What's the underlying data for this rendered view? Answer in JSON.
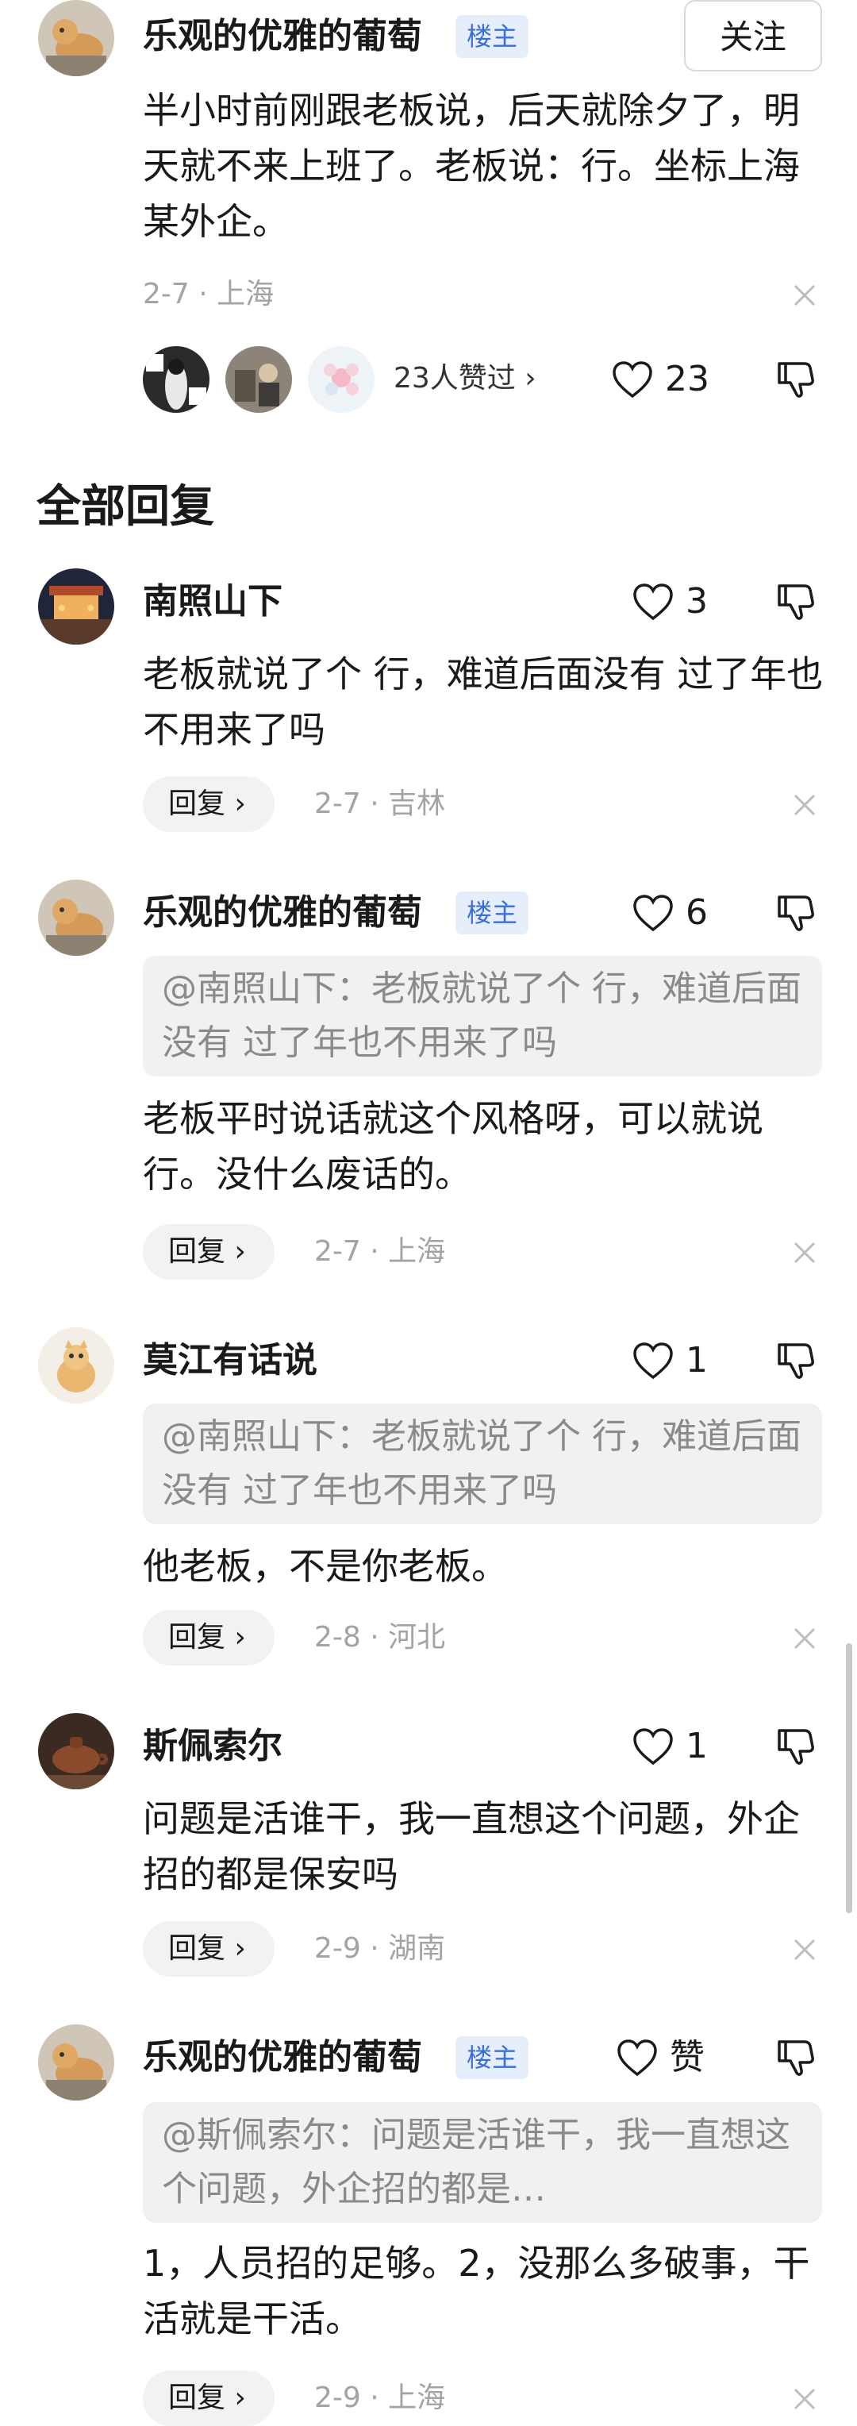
{
  "colors": {
    "accent_badge": "#3b6fd8",
    "badge_bg": "#e7eefb",
    "meta": "#a3a3a3"
  },
  "top_comment": {
    "author": "乐观的优雅的葡萄",
    "badge": "楼主",
    "follow_label": "关注",
    "text": "半小时前刚跟老板说，后天就除夕了，明天就不来上班了。老板说：行。坐标上海某外企。",
    "meta": "2-7 · 上海",
    "likers_label": "23人赞过 ›",
    "like_count": "23",
    "icons": {
      "like": "heart-icon",
      "dislike": "thumbs-down-icon",
      "close": "close-icon"
    }
  },
  "section_title": "全部回复",
  "replies": [
    {
      "author": "南照山下",
      "badge": "",
      "like_count": "3",
      "quote": "",
      "text": "老板就说了个 行，难道后面没有 过了年也不用来了吗",
      "reply_label": "回复 ›",
      "meta": "2-7 · 吉林"
    },
    {
      "author": "乐观的优雅的葡萄",
      "badge": "楼主",
      "like_count": "6",
      "quote": "@南照山下：老板就说了个 行，难道后面没有 过了年也不用来了吗",
      "text": "老板平时说话就这个风格呀，可以就说行。没什么废话的。",
      "reply_label": "回复 ›",
      "meta": "2-7 · 上海"
    },
    {
      "author": "莫江有话说",
      "badge": "",
      "like_count": "1",
      "quote": "@南照山下：老板就说了个 行，难道后面没有 过了年也不用来了吗",
      "text": "他老板，不是你老板。",
      "reply_label": "回复 ›",
      "meta": "2-8 · 河北"
    },
    {
      "author": "斯佩索尔",
      "badge": "",
      "like_count": "1",
      "quote": "",
      "text": "问题是活谁干，我一直想这个问题，外企招的都是保安吗",
      "reply_label": "回复 ›",
      "meta": "2-9 · 湖南"
    },
    {
      "author": "乐观的优雅的葡萄",
      "badge": "楼主",
      "like_count": "赞",
      "quote": "@斯佩索尔：问题是活谁干，我一直想这个问题，外企招的都是…",
      "text": "1，人员招的足够。2，没那么多破事，干活就是干活。",
      "reply_label": "回复 ›",
      "meta": "2-9 · 上海"
    }
  ]
}
